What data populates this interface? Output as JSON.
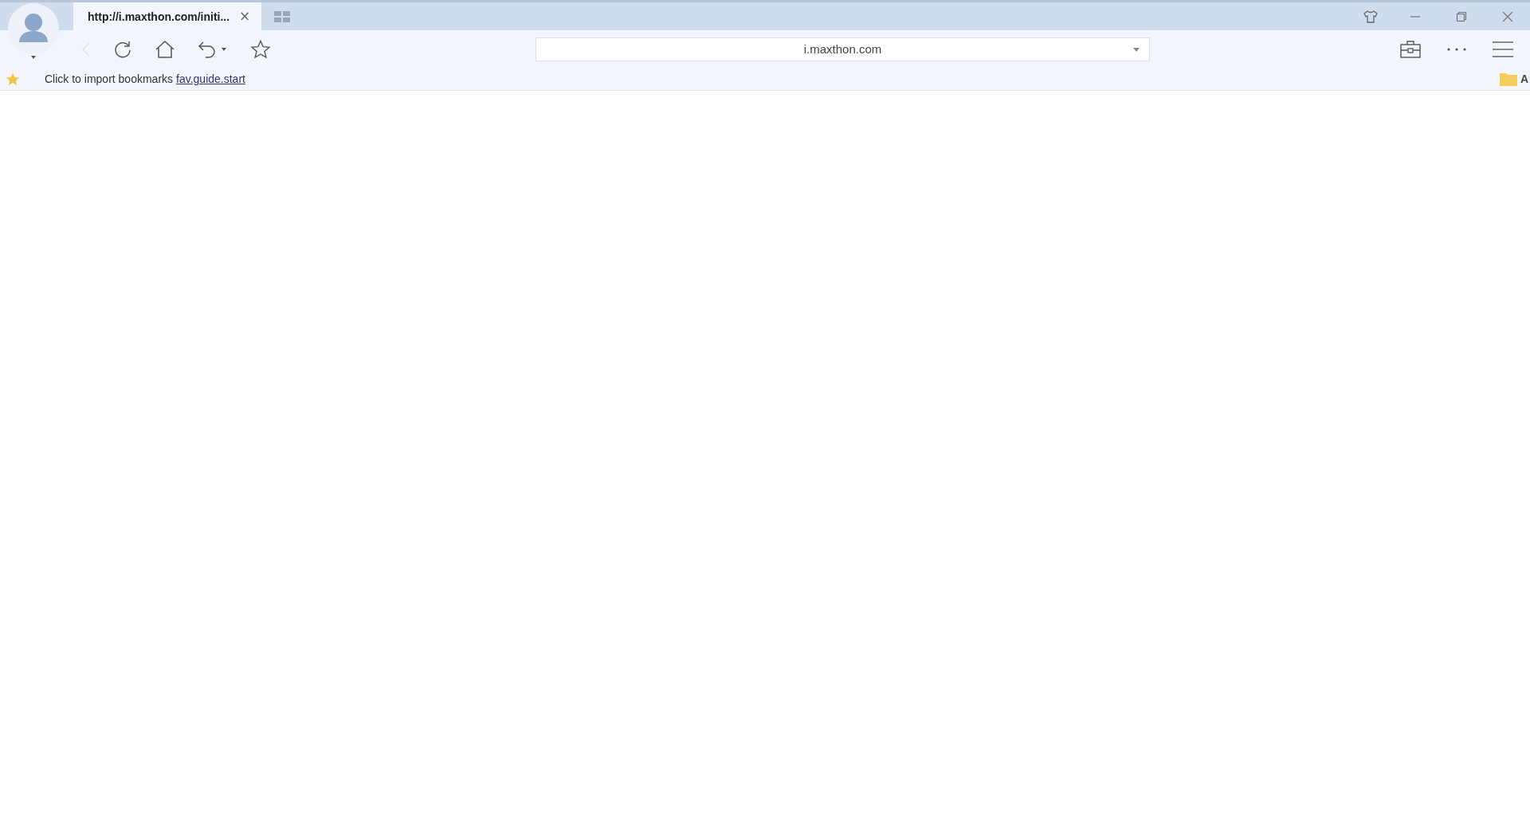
{
  "tabs": [
    {
      "title": "http://i.maxthon.com/initi...",
      "close": "×",
      "selected": true
    }
  ],
  "address_bar": {
    "value": "i.maxthon.com"
  },
  "bookmarks_bar": {
    "import_text": "Click to import bookmarks",
    "import_link": "fav.guide.start",
    "folder_label": "A"
  }
}
